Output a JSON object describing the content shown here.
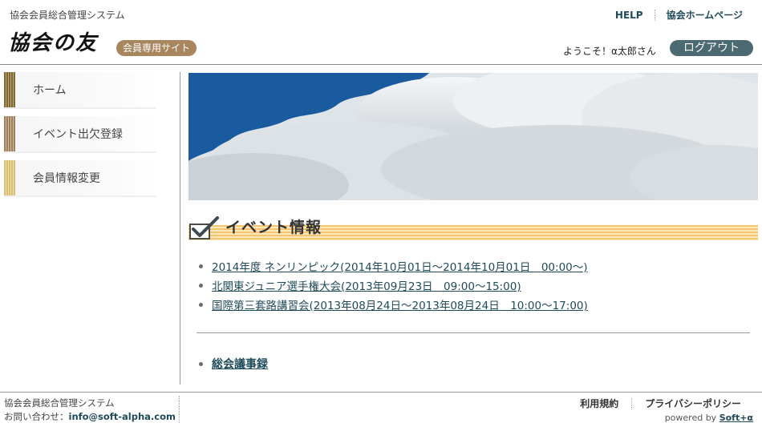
{
  "header": {
    "system_title": "協会会員総合管理システム",
    "logo": "協会の友",
    "member_badge": "会員専用サイト",
    "top_links": [
      "HELP",
      "協会ホームページ"
    ],
    "welcome": "ようこそ！α太郎さん",
    "logout_label": "ログアウト"
  },
  "sidebar": {
    "items": [
      {
        "label": "ホーム"
      },
      {
        "label": "イベント出欠登録"
      },
      {
        "label": "会員情報変更"
      }
    ]
  },
  "main": {
    "event_heading": "イベント情報",
    "events": [
      "2014年度 ネンリンピック(2014年10月01日～2014年10月01日　00:00～)",
      "北関東ジュニア選手権大会(2013年09月23日　09:00～15:00)",
      "国際第三套路講習会(2013年08月24日～2013年08月24日　10:00～17:00)"
    ],
    "minutes_link": "総会議事録"
  },
  "footer": {
    "system_name": "協会会員総合管理システム",
    "contact_label": "お問い合わせ：",
    "contact_email": "info@soft-alpha.com",
    "links": [
      "利用規約",
      "プライバシーポリシー"
    ],
    "powered_by": "powered by",
    "powered_brand": "Soft+α"
  },
  "colors": {
    "link": "#1f4a5a",
    "logout_bg": "#4c6a72",
    "badge_bg": "#a8875f",
    "sky_blue": "#1a5a9e",
    "event_bar": "#f4c570"
  }
}
